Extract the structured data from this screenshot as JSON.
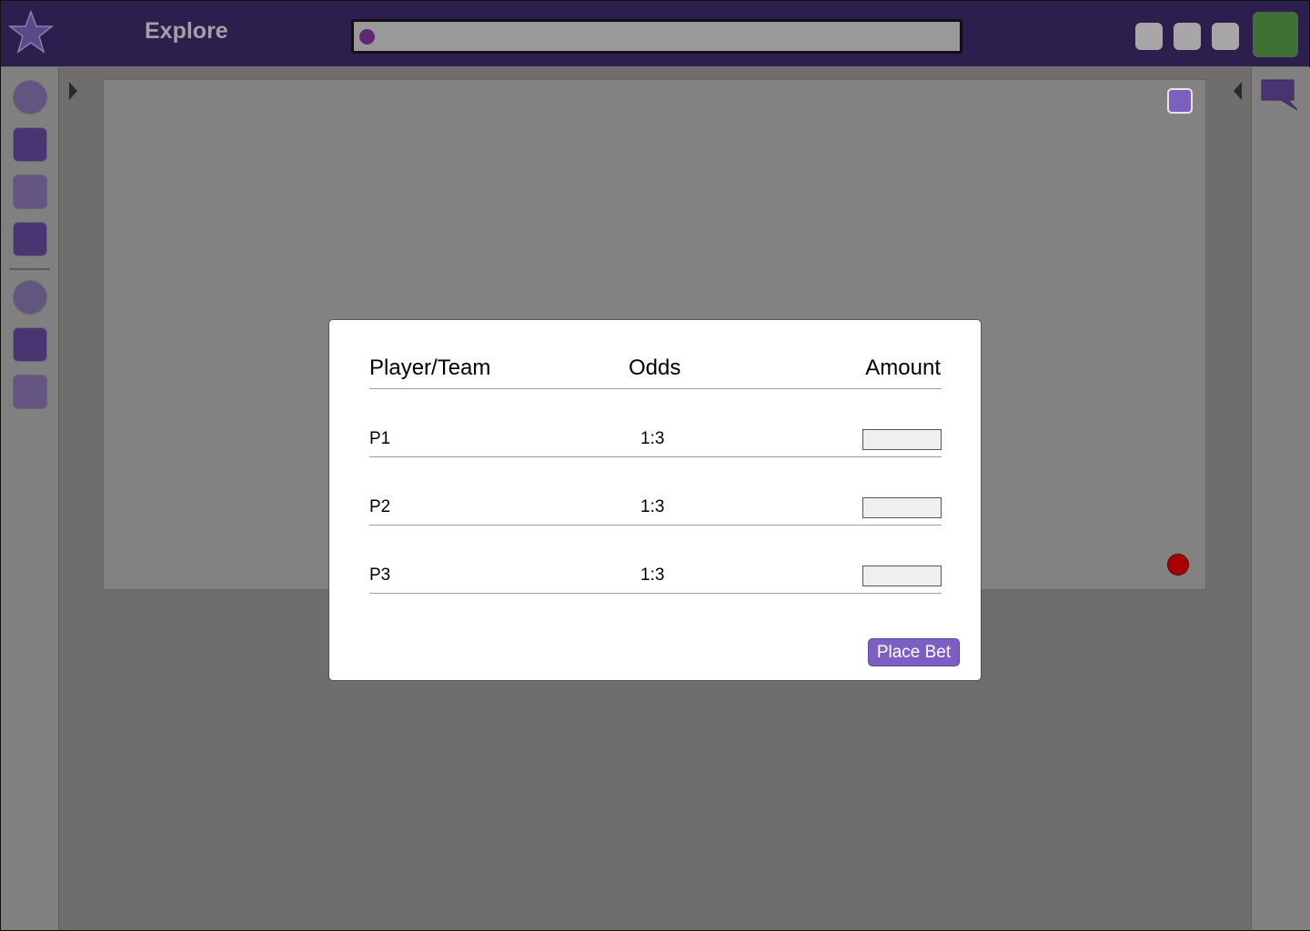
{
  "app": {
    "title": "Explore"
  },
  "colors": {
    "topbar": "#2d1f4d",
    "accent": "#7d5fc4",
    "avatar": "#3e7133",
    "record": "#a60000"
  },
  "search": {
    "value": "",
    "placeholder": ""
  },
  "modal": {
    "headers": {
      "player": "Player/Team",
      "odds": "Odds",
      "amount": "Amount"
    },
    "rows": [
      {
        "player": "P1",
        "odds": "1:3",
        "amount": ""
      },
      {
        "player": "P2",
        "odds": "1:3",
        "amount": ""
      },
      {
        "player": "P3",
        "odds": "1:3",
        "amount": ""
      }
    ],
    "submit_label": "Place Bet"
  },
  "icons": {
    "logo": "star-icon",
    "left_toggle": "caret-right-icon",
    "right_toggle": "caret-left-icon",
    "chat": "speech-bubble-icon"
  }
}
